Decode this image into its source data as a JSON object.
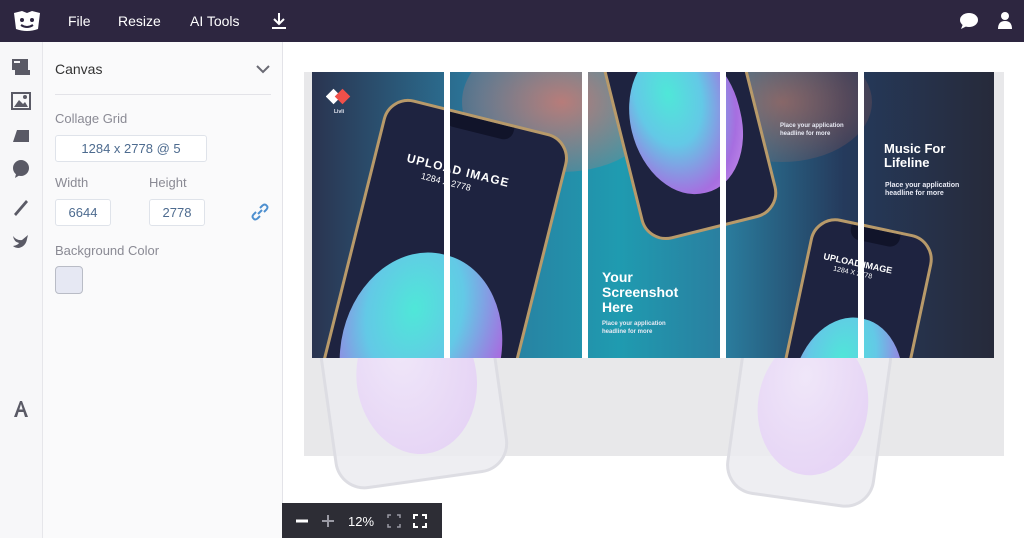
{
  "topbar": {
    "menu": [
      {
        "label": "File"
      },
      {
        "label": "Resize"
      },
      {
        "label": "AI Tools"
      }
    ]
  },
  "panel": {
    "title": "Canvas",
    "collage_grid_label": "Collage Grid",
    "collage_grid_value": "1284 x 2778 @ 5",
    "width_label": "Width",
    "width_value": "6644",
    "height_label": "Height",
    "height_value": "2778",
    "background_color_label": "Background Color",
    "background_color_value": "#e6e8f3"
  },
  "canvas": {
    "brand_label": "Livli",
    "upload_text_1": "UPLOAD IMAGE",
    "upload_size_1": "1284 X 2778",
    "upload_text_2": "UPLOAD IMAGE",
    "upload_size_2": "1284 X 2778",
    "headline_screenshot": "Your Screenshot Here",
    "sub_screenshot": "Place your application headline for more",
    "headline_top": "Place your application headline for more",
    "music_title": "Music For Lifeline",
    "music_sub": "Place your application headline for more"
  },
  "zoom": {
    "level": "12%"
  },
  "colors": {
    "topbar": "#2d2640",
    "accent": "#4d8fcf"
  }
}
